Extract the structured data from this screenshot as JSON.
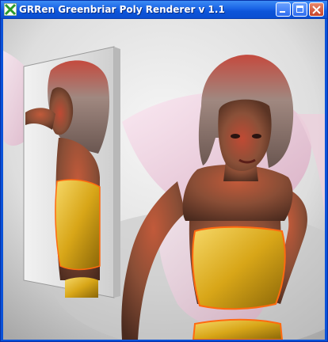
{
  "window": {
    "title": "GRRen Greenbriar Poly Renderer v 1.1",
    "app_icon": "green-x-app-icon",
    "buttons": [
      "minimize-icon",
      "maximize-icon",
      "close-icon"
    ]
  },
  "scene": {
    "description_icon": "rendered-3d-scene",
    "colors": {
      "background": "#e8e8e8",
      "wing": "#f2d8e6",
      "skin": "#8a5036",
      "hair": "#9a8078",
      "top": "#e8b81a",
      "accent": "#ff6a10"
    }
  }
}
